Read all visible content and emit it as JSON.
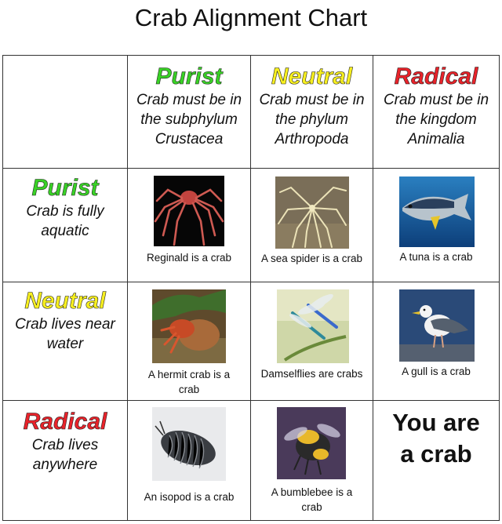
{
  "title": "Crab Alignment Chart",
  "columns": [
    {
      "label": "Purist",
      "color": "#39d226",
      "desc": [
        "Crab must be in",
        "the subphylum",
        "Crustacea"
      ]
    },
    {
      "label": "Neutral",
      "color": "#f7ef1f",
      "desc": [
        "Crab must be in",
        "the phylum",
        "Arthropoda"
      ]
    },
    {
      "label": "Radical",
      "color": "#e8232a",
      "desc": [
        "Crab must be in",
        "the kingdom",
        "Animalia"
      ]
    }
  ],
  "rows": [
    {
      "label": "Purist",
      "color": "#39d226",
      "desc": [
        "Crab is fully",
        "aquatic"
      ]
    },
    {
      "label": "Neutral",
      "color": "#f7ef1f",
      "desc": [
        "Crab lives near",
        "water"
      ]
    },
    {
      "label": "Radical",
      "color": "#e8232a",
      "desc": [
        "Crab lives",
        "anywhere"
      ]
    }
  ],
  "cells": [
    {
      "caption": [
        "Reginald is a crab"
      ],
      "image": "spider-crab-photo"
    },
    {
      "caption": [
        "A sea spider is a crab"
      ],
      "image": "sea-spider-photo"
    },
    {
      "caption": [
        "A tuna is a crab"
      ],
      "image": "tuna-photo"
    },
    {
      "caption": [
        "A hermit crab is a",
        "crab"
      ],
      "image": "hermit-crab-photo"
    },
    {
      "caption": [
        "Damselflies are crabs"
      ],
      "image": "damselflies-photo"
    },
    {
      "caption": [
        "A gull is a crab"
      ],
      "image": "gull-photo"
    },
    {
      "caption": [
        "An isopod is a crab"
      ],
      "image": "isopod-photo"
    },
    {
      "caption": [
        "A bumblebee is a",
        "crab"
      ],
      "image": "bumblebee-photo"
    },
    {
      "caption": [
        "You are",
        "a crab"
      ],
      "image": ""
    }
  ]
}
